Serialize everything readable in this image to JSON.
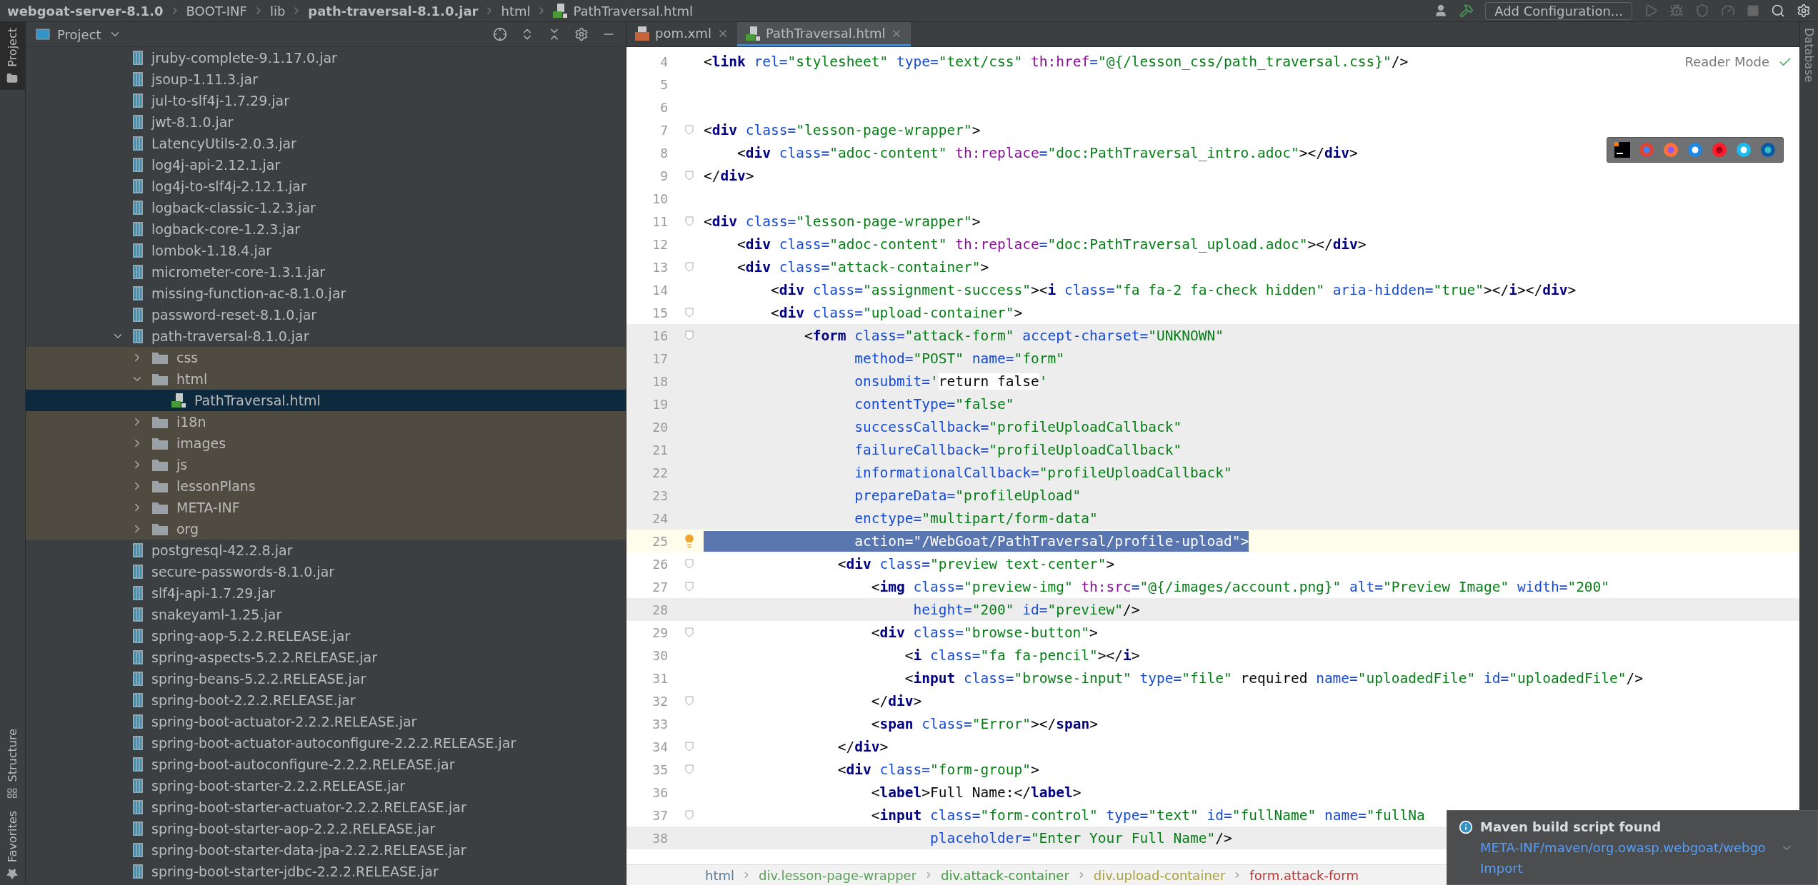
{
  "navigation_bar": {
    "crumbs": [
      {
        "label": "webgoat-server-8.1.0",
        "kind": "module"
      },
      {
        "label": "BOOT-INF",
        "kind": "folder"
      },
      {
        "label": "lib",
        "kind": "folder"
      },
      {
        "label": "path-traversal-8.1.0.jar",
        "kind": "module"
      },
      {
        "label": "html",
        "kind": "folder"
      },
      {
        "label": "PathTraversal.html",
        "kind": "file"
      }
    ],
    "run_configuration": "Add Configuration..."
  },
  "left_tool_strip": {
    "top": [
      {
        "label": "Project",
        "selected": true
      }
    ],
    "bottom": [
      {
        "label": "Structure",
        "kind": "structure"
      },
      {
        "label": "Favorites",
        "kind": "favorites"
      }
    ]
  },
  "right_tool_strip": [
    {
      "label": "Database"
    }
  ],
  "project_panel": {
    "title": "Project",
    "tree": [
      {
        "label": "jruby-complete-9.1.17.0.jar",
        "kind": "jar",
        "selected": false
      },
      {
        "label": "jsoup-1.11.3.jar",
        "kind": "jar",
        "selected": false
      },
      {
        "label": "jul-to-slf4j-1.7.29.jar",
        "kind": "jar",
        "selected": false
      },
      {
        "label": "jwt-8.1.0.jar",
        "kind": "jar",
        "selected": false
      },
      {
        "label": "LatencyUtils-2.0.3.jar",
        "kind": "jar",
        "selected": false
      },
      {
        "label": "log4j-api-2.12.1.jar",
        "kind": "jar",
        "selected": false
      },
      {
        "label": "log4j-to-slf4j-2.12.1.jar",
        "kind": "jar",
        "selected": false
      },
      {
        "label": "logback-classic-1.2.3.jar",
        "kind": "jar",
        "selected": false
      },
      {
        "label": "logback-core-1.2.3.jar",
        "kind": "jar",
        "selected": false
      },
      {
        "label": "lombok-1.18.4.jar",
        "kind": "jar",
        "selected": false
      },
      {
        "label": "micrometer-core-1.3.1.jar",
        "kind": "jar",
        "selected": false
      },
      {
        "label": "missing-function-ac-8.1.0.jar",
        "kind": "jar",
        "selected": false
      },
      {
        "label": "password-reset-8.1.0.jar",
        "kind": "jar",
        "selected": false
      },
      {
        "label": "path-traversal-8.1.0.jar",
        "kind": "jar",
        "selected": false,
        "expanded": true,
        "children": [
          {
            "label": "css",
            "kind": "folder",
            "selected": false,
            "expanded": false
          },
          {
            "label": "html",
            "kind": "folder",
            "selected": false,
            "expanded": true,
            "children": [
              {
                "label": "PathTraversal.html",
                "kind": "html",
                "selected": true
              }
            ]
          },
          {
            "label": "i18n",
            "kind": "folder",
            "selected": false,
            "expanded": false
          },
          {
            "label": "images",
            "kind": "folder",
            "selected": false,
            "expanded": false
          },
          {
            "label": "js",
            "kind": "folder",
            "selected": false,
            "expanded": false
          },
          {
            "label": "lessonPlans",
            "kind": "folder",
            "selected": false,
            "expanded": false
          },
          {
            "label": "META-INF",
            "kind": "folder",
            "selected": false,
            "expanded": false
          },
          {
            "label": "org",
            "kind": "folder",
            "selected": false,
            "expanded": false
          }
        ]
      },
      {
        "label": "postgresql-42.2.8.jar",
        "kind": "jar",
        "selected": false
      },
      {
        "label": "secure-passwords-8.1.0.jar",
        "kind": "jar",
        "selected": false
      },
      {
        "label": "slf4j-api-1.7.29.jar",
        "kind": "jar",
        "selected": false
      },
      {
        "label": "snakeyaml-1.25.jar",
        "kind": "jar",
        "selected": false
      },
      {
        "label": "spring-aop-5.2.2.RELEASE.jar",
        "kind": "jar",
        "selected": false
      },
      {
        "label": "spring-aspects-5.2.2.RELEASE.jar",
        "kind": "jar",
        "selected": false
      },
      {
        "label": "spring-beans-5.2.2.RELEASE.jar",
        "kind": "jar",
        "selected": false
      },
      {
        "label": "spring-boot-2.2.2.RELEASE.jar",
        "kind": "jar",
        "selected": false
      },
      {
        "label": "spring-boot-actuator-2.2.2.RELEASE.jar",
        "kind": "jar",
        "selected": false
      },
      {
        "label": "spring-boot-actuator-autoconfigure-2.2.2.RELEASE.jar",
        "kind": "jar",
        "selected": false
      },
      {
        "label": "spring-boot-autoconfigure-2.2.2.RELEASE.jar",
        "kind": "jar",
        "selected": false
      },
      {
        "label": "spring-boot-starter-2.2.2.RELEASE.jar",
        "kind": "jar",
        "selected": false
      },
      {
        "label": "spring-boot-starter-actuator-2.2.2.RELEASE.jar",
        "kind": "jar",
        "selected": false
      },
      {
        "label": "spring-boot-starter-aop-2.2.2.RELEASE.jar",
        "kind": "jar",
        "selected": false
      },
      {
        "label": "spring-boot-starter-data-jpa-2.2.2.RELEASE.jar",
        "kind": "jar",
        "selected": false
      },
      {
        "label": "spring-boot-starter-jdbc-2.2.2.RELEASE.jar",
        "kind": "jar",
        "selected": false
      }
    ]
  },
  "editor": {
    "tabs": [
      {
        "label": "pom.xml",
        "kind": "xml",
        "selected": false
      },
      {
        "label": "PathTraversal.html",
        "kind": "html",
        "selected": true
      }
    ],
    "reader_mode": "Reader Mode",
    "lines": [
      {
        "number": "4",
        "code": "<link rel=\"stylesheet\" type=\"text/css\" th:href=\"@{/lesson_css/path_traversal.css}\"/>",
        "fold": false,
        "shaded": false,
        "selected": false
      },
      {
        "number": "5",
        "fold": false,
        "shaded": false,
        "selected": false
      },
      {
        "number": "6",
        "fold": false,
        "shaded": false,
        "selected": false
      },
      {
        "number": "7",
        "code": "<div class=\"lesson-page-wrapper\">",
        "fold": true,
        "shaded": false,
        "selected": false
      },
      {
        "number": "8",
        "code": "    <div class=\"adoc-content\" th:replace=\"doc:PathTraversal_intro.adoc\"></div>",
        "fold": false,
        "shaded": false,
        "selected": false
      },
      {
        "number": "9",
        "code": "</div>",
        "fold": true,
        "shaded": false,
        "selected": false
      },
      {
        "number": "10",
        "fold": false,
        "shaded": false,
        "selected": false
      },
      {
        "number": "11",
        "code": "<div class=\"lesson-page-wrapper\">",
        "fold": true,
        "shaded": false,
        "selected": false
      },
      {
        "number": "12",
        "code": "    <div class=\"adoc-content\" th:replace=\"doc:PathTraversal_upload.adoc\"></div>",
        "fold": false,
        "shaded": false,
        "selected": false
      },
      {
        "number": "13",
        "code": "    <div class=\"attack-container\">",
        "fold": true,
        "shaded": false,
        "selected": false
      },
      {
        "number": "14",
        "code": "        <div class=\"assignment-success\"><i class=\"fa fa-2 fa-check hidden\" aria-hidden=\"true\"></i></div>",
        "fold": false,
        "shaded": false,
        "selected": false
      },
      {
        "number": "15",
        "code": "        <div class=\"upload-container\">",
        "fold": true,
        "shaded": false,
        "selected": false
      },
      {
        "number": "16",
        "code": "            <form class=\"attack-form\" accept-charset=\"UNKNOWN\"",
        "fold": true,
        "shaded": true,
        "selected": false
      },
      {
        "number": "17",
        "code": "                  method=\"POST\" name=\"form\"",
        "fold": false,
        "shaded": true,
        "selected": false
      },
      {
        "number": "18",
        "code": "                  onsubmit='return false'",
        "fold": false,
        "shaded": true,
        "selected": false
      },
      {
        "number": "19",
        "code": "                  contentType=\"false\"",
        "fold": false,
        "shaded": true,
        "selected": false
      },
      {
        "number": "20",
        "code": "                  successCallback=\"profileUploadCallback\"",
        "fold": false,
        "shaded": true,
        "selected": false
      },
      {
        "number": "21",
        "code": "                  failureCallback=\"profileUploadCallback\"",
        "fold": false,
        "shaded": true,
        "selected": false
      },
      {
        "number": "22",
        "code": "                  informationalCallback=\"profileUploadCallback\"",
        "fold": false,
        "shaded": true,
        "selected": false
      },
      {
        "number": "23",
        "code": "                  prepareData=\"profileUpload\"",
        "fold": false,
        "shaded": true,
        "selected": false
      },
      {
        "number": "24",
        "code": "                  enctype=\"multipart/form-data\"",
        "fold": false,
        "shaded": true,
        "selected": false
      },
      {
        "number": "25",
        "code": "                  action=\"/WebGoat/PathTraversal/profile-upload\">",
        "fold": false,
        "shaded": false,
        "selected": true
      },
      {
        "number": "26",
        "code": "                <div class=\"preview text-center\">",
        "fold": true,
        "shaded": false,
        "selected": false
      },
      {
        "number": "27",
        "code": "                    <img class=\"preview-img\" th:src=\"@{/images/account.png}\" alt=\"Preview Image\" width=\"200\"",
        "fold": true,
        "shaded": false,
        "selected": false
      },
      {
        "number": "28",
        "code": "                         height=\"200\" id=\"preview\"/>",
        "fold": false,
        "shaded": true,
        "selected": false
      },
      {
        "number": "29",
        "code": "                    <div class=\"browse-button\">",
        "fold": true,
        "shaded": false,
        "selected": false
      },
      {
        "number": "30",
        "code": "                        <i class=\"fa fa-pencil\"></i>",
        "fold": false,
        "shaded": false,
        "selected": false
      },
      {
        "number": "31",
        "code": "                        <input class=\"browse-input\" type=\"file\" required name=\"uploadedFile\" id=\"uploadedFile\"/>",
        "fold": false,
        "shaded": false,
        "selected": false
      },
      {
        "number": "32",
        "code": "                    </div>",
        "fold": true,
        "shaded": false,
        "selected": false
      },
      {
        "number": "33",
        "code": "                    <span class=\"Error\"></span>",
        "fold": false,
        "shaded": false,
        "selected": false
      },
      {
        "number": "34",
        "code": "                </div>",
        "fold": true,
        "shaded": false,
        "selected": false
      },
      {
        "number": "35",
        "code": "                <div class=\"form-group\">",
        "fold": true,
        "shaded": false,
        "selected": false
      },
      {
        "number": "36",
        "code": "                    <label>Full Name:</label>",
        "fold": false,
        "shaded": false,
        "selected": false
      },
      {
        "number": "37",
        "code": "                    <input class=\"form-control\" type=\"text\" id=\"fullName\" name=\"fullNa",
        "fold": true,
        "shaded": false,
        "selected": false
      },
      {
        "number": "38",
        "code": "                           placeholder=\"Enter Your Full Name\"/>",
        "fold": false,
        "shaded": true,
        "selected": false
      }
    ],
    "breadcrumb": [
      {
        "label": "html",
        "color": "#5a7a9a"
      },
      {
        "label": "div.lesson-page-wrapper",
        "color": "#5aa05a"
      },
      {
        "label": "div.attack-container",
        "color": "#3e9a3e"
      },
      {
        "label": "div.upload-container",
        "color": "#a8a23a"
      },
      {
        "label": "form.attack-form",
        "color": "#b83a3a"
      }
    ]
  },
  "notification": {
    "title": "Maven build script found",
    "link": "META-INF/maven/org.owasp.webgoat/webgo",
    "action": "Import"
  }
}
